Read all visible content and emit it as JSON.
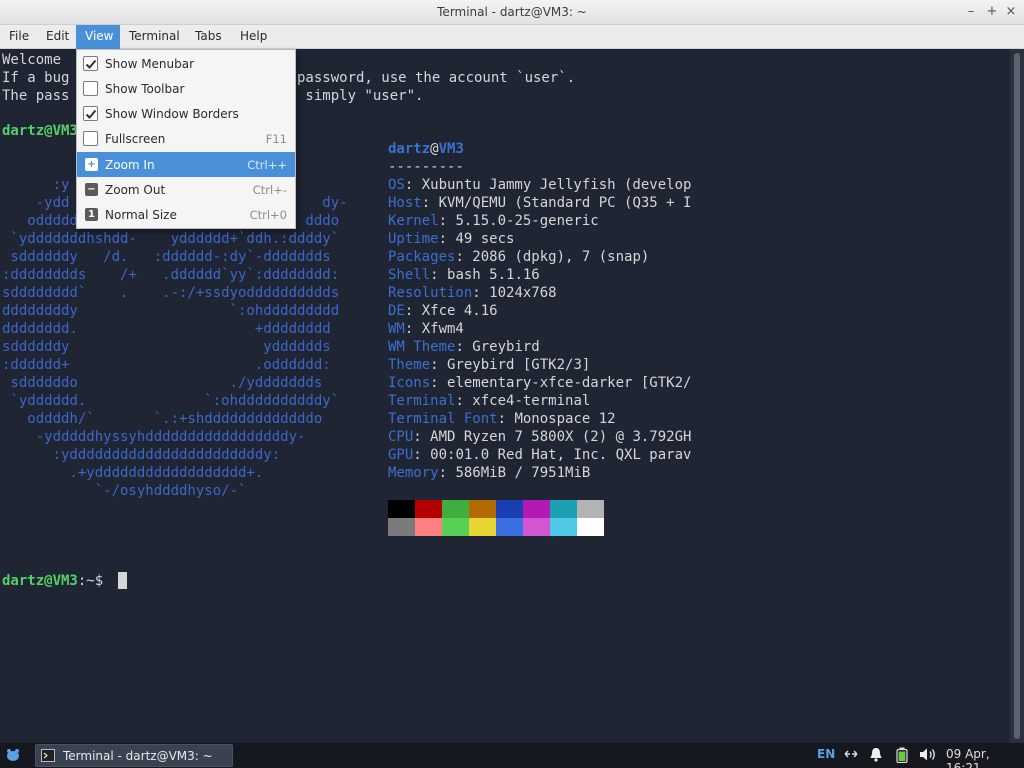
{
  "window": {
    "title": "Terminal - dartz@VM3: ~",
    "minimize_icon": "minimize-icon",
    "maximize_icon": "maximize-icon",
    "close_icon": "close-icon"
  },
  "menubar": {
    "items": [
      "File",
      "Edit",
      "View",
      "Terminal",
      "Tabs",
      "Help"
    ],
    "active": "View"
  },
  "view_menu": {
    "items": [
      {
        "label": "Show Menubar",
        "type": "check",
        "checked": true,
        "shortcut": ""
      },
      {
        "label": "Show Toolbar",
        "type": "check",
        "checked": false,
        "shortcut": ""
      },
      {
        "label": "Show Window Borders",
        "type": "check",
        "checked": true,
        "shortcut": ""
      },
      {
        "label": "Fullscreen",
        "type": "check",
        "checked": false,
        "shortcut": "F11"
      },
      {
        "label": "Zoom In",
        "type": "icon",
        "icon": "+",
        "shortcut": "Ctrl++",
        "highlighted": true
      },
      {
        "label": "Zoom Out",
        "type": "icon",
        "icon": "−",
        "shortcut": "Ctrl+-"
      },
      {
        "label": "Normal Size",
        "type": "icon",
        "icon": "1",
        "shortcut": "Ctrl+0"
      }
    ]
  },
  "terminal": {
    "welcome": [
      "Welcome ",
      "If a bug",
      "The pass"
    ],
    "welcome_tail": [
      "",
      "password, use the account `user`.",
      " simply \"user\"."
    ],
    "prompt_user": "dartz@VM3",
    "prompt_suffix": ":~$",
    "info_header_user": "dartz",
    "info_header_at": "@",
    "info_header_host": "VM3",
    "info_sep": "---------",
    "info": [
      {
        "label": "OS",
        "value": "Xubuntu Jammy Jellyfish (develop"
      },
      {
        "label": "Host",
        "value": "KVM/QEMU (Standard PC (Q35 + I"
      },
      {
        "label": "Kernel",
        "value": "5.15.0-25-generic"
      },
      {
        "label": "Uptime",
        "value": "49 secs"
      },
      {
        "label": "Packages",
        "value": "2086 (dpkg), 7 (snap)"
      },
      {
        "label": "Shell",
        "value": "bash 5.1.16"
      },
      {
        "label": "Resolution",
        "value": "1024x768"
      },
      {
        "label": "DE",
        "value": "Xfce 4.16"
      },
      {
        "label": "WM",
        "value": "Xfwm4"
      },
      {
        "label": "WM Theme",
        "value": "Greybird"
      },
      {
        "label": "Theme",
        "value": "Greybird [GTK2/3]"
      },
      {
        "label": "Icons",
        "value": "elementary-xfce-darker [GTK2/"
      },
      {
        "label": "Terminal",
        "value": "xfce4-terminal"
      },
      {
        "label": "Terminal Font",
        "value": "Monospace 12"
      },
      {
        "label": "CPU",
        "value": "AMD Ryzen 7 5800X (2) @ 3.792GH"
      },
      {
        "label": "GPU",
        "value": "00:01.0 Red Hat, Inc. QXL parav"
      },
      {
        "label": "Memory",
        "value": "586MiB / 7951MiB"
      }
    ],
    "ascii_art": [
      "      :y",
      "    -ydd                              dy-",
      "   oddddd                           dddo",
      " `ydddddddhshdd-    ydddddd+`ddh.:ddddy`",
      " sddddddy   /d.   :dddddd-:dy`-ddddddds",
      ":dddddddds    /+   .dddddd`yy`:dddddddd:",
      "sdddddddd`    .    .-:/+ssdyodddddddddds",
      "ddddddddy                  `:ohddddddddd",
      "dddddddd.                     +dddddddd",
      "sddddddy                       ydddddds",
      ":dddddd+                      .odddddd:",
      " sddddddo                  ./yddddddds",
      " `ydddddd.              `:ohddddddddddy`",
      "   oddddh/`       `.:+shdddddddddddddo",
      "    -ydddddhyssyhdddddddddddddddddy-",
      "      :ydddddddddddddddddddddddy:",
      "        .+ydddddddddddddddddd+.",
      "           `-/osyhddddhyso/-`"
    ],
    "palette_top": [
      "#000000",
      "#b30000",
      "#3fae3f",
      "#b36b00",
      "#1a3fb3",
      "#b31ab3",
      "#1a9fb3",
      "#b3b3b3"
    ],
    "palette_bottom": [
      "#7a7a7a",
      "#ff8080",
      "#55d055",
      "#e6d633",
      "#3b6fe0",
      "#d255d2",
      "#4fc8e6",
      "#ffffff"
    ]
  },
  "taskbar": {
    "menu_icon": "xfce-mouse-icon",
    "task_label": "Terminal - dartz@VM3: ~",
    "keyboard_layout": "EN",
    "network_icon": "network-icon",
    "notification_icon": "bell-icon",
    "battery_icon": "battery-icon",
    "volume_icon": "volume-icon",
    "clock": "09 Apr, 16:21"
  }
}
